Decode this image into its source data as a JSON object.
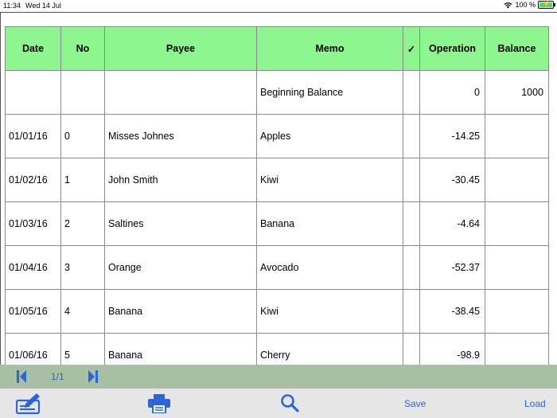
{
  "status_bar": {
    "time": "11:34",
    "date": "Wed 14 Jul",
    "battery": "100 %"
  },
  "table": {
    "headers": {
      "date": "Date",
      "no": "No",
      "payee": "Payee",
      "memo": "Memo",
      "check": "✓",
      "operation": "Operation",
      "balance": "Balance"
    },
    "rows": [
      {
        "date": "",
        "no": "",
        "payee": "",
        "memo": "Beginning Balance",
        "check": "",
        "operation": "0",
        "balance": "1000"
      },
      {
        "date": "01/01/16",
        "no": "0",
        "payee": "Misses Johnes",
        "memo": "Apples",
        "check": "",
        "operation": "-14.25",
        "balance": ""
      },
      {
        "date": "01/02/16",
        "no": "1",
        "payee": "John Smith",
        "memo": "Kiwi",
        "check": "",
        "operation": "-30.45",
        "balance": ""
      },
      {
        "date": "01/03/16",
        "no": "2",
        "payee": "Saltines",
        "memo": "Banana",
        "check": "",
        "operation": "-4.64",
        "balance": ""
      },
      {
        "date": "01/04/16",
        "no": "3",
        "payee": "Orange",
        "memo": "Avocado",
        "check": "",
        "operation": "-52.37",
        "balance": ""
      },
      {
        "date": "01/05/16",
        "no": "4",
        "payee": "Banana",
        "memo": "Kiwi",
        "check": "",
        "operation": "-38.45",
        "balance": ""
      },
      {
        "date": "01/06/16",
        "no": "5",
        "payee": "Banana",
        "memo": "Cherry",
        "check": "",
        "operation": "-98.9",
        "balance": ""
      }
    ]
  },
  "navigation": {
    "page_indicator": "1/1",
    "first_icon": "skip-to-first-icon",
    "last_icon": "skip-to-last-icon"
  },
  "toolbar": {
    "check_icon": "write-check-icon",
    "print_icon": "printer-icon",
    "search_icon": "search-icon",
    "save_label": "Save",
    "load_label": "Load"
  },
  "colors": {
    "header_bg": "#8ef68e",
    "nav_bg": "#a9bfa4",
    "toolbar_bg": "#e6e6e6",
    "accent": "#2a66d9"
  }
}
